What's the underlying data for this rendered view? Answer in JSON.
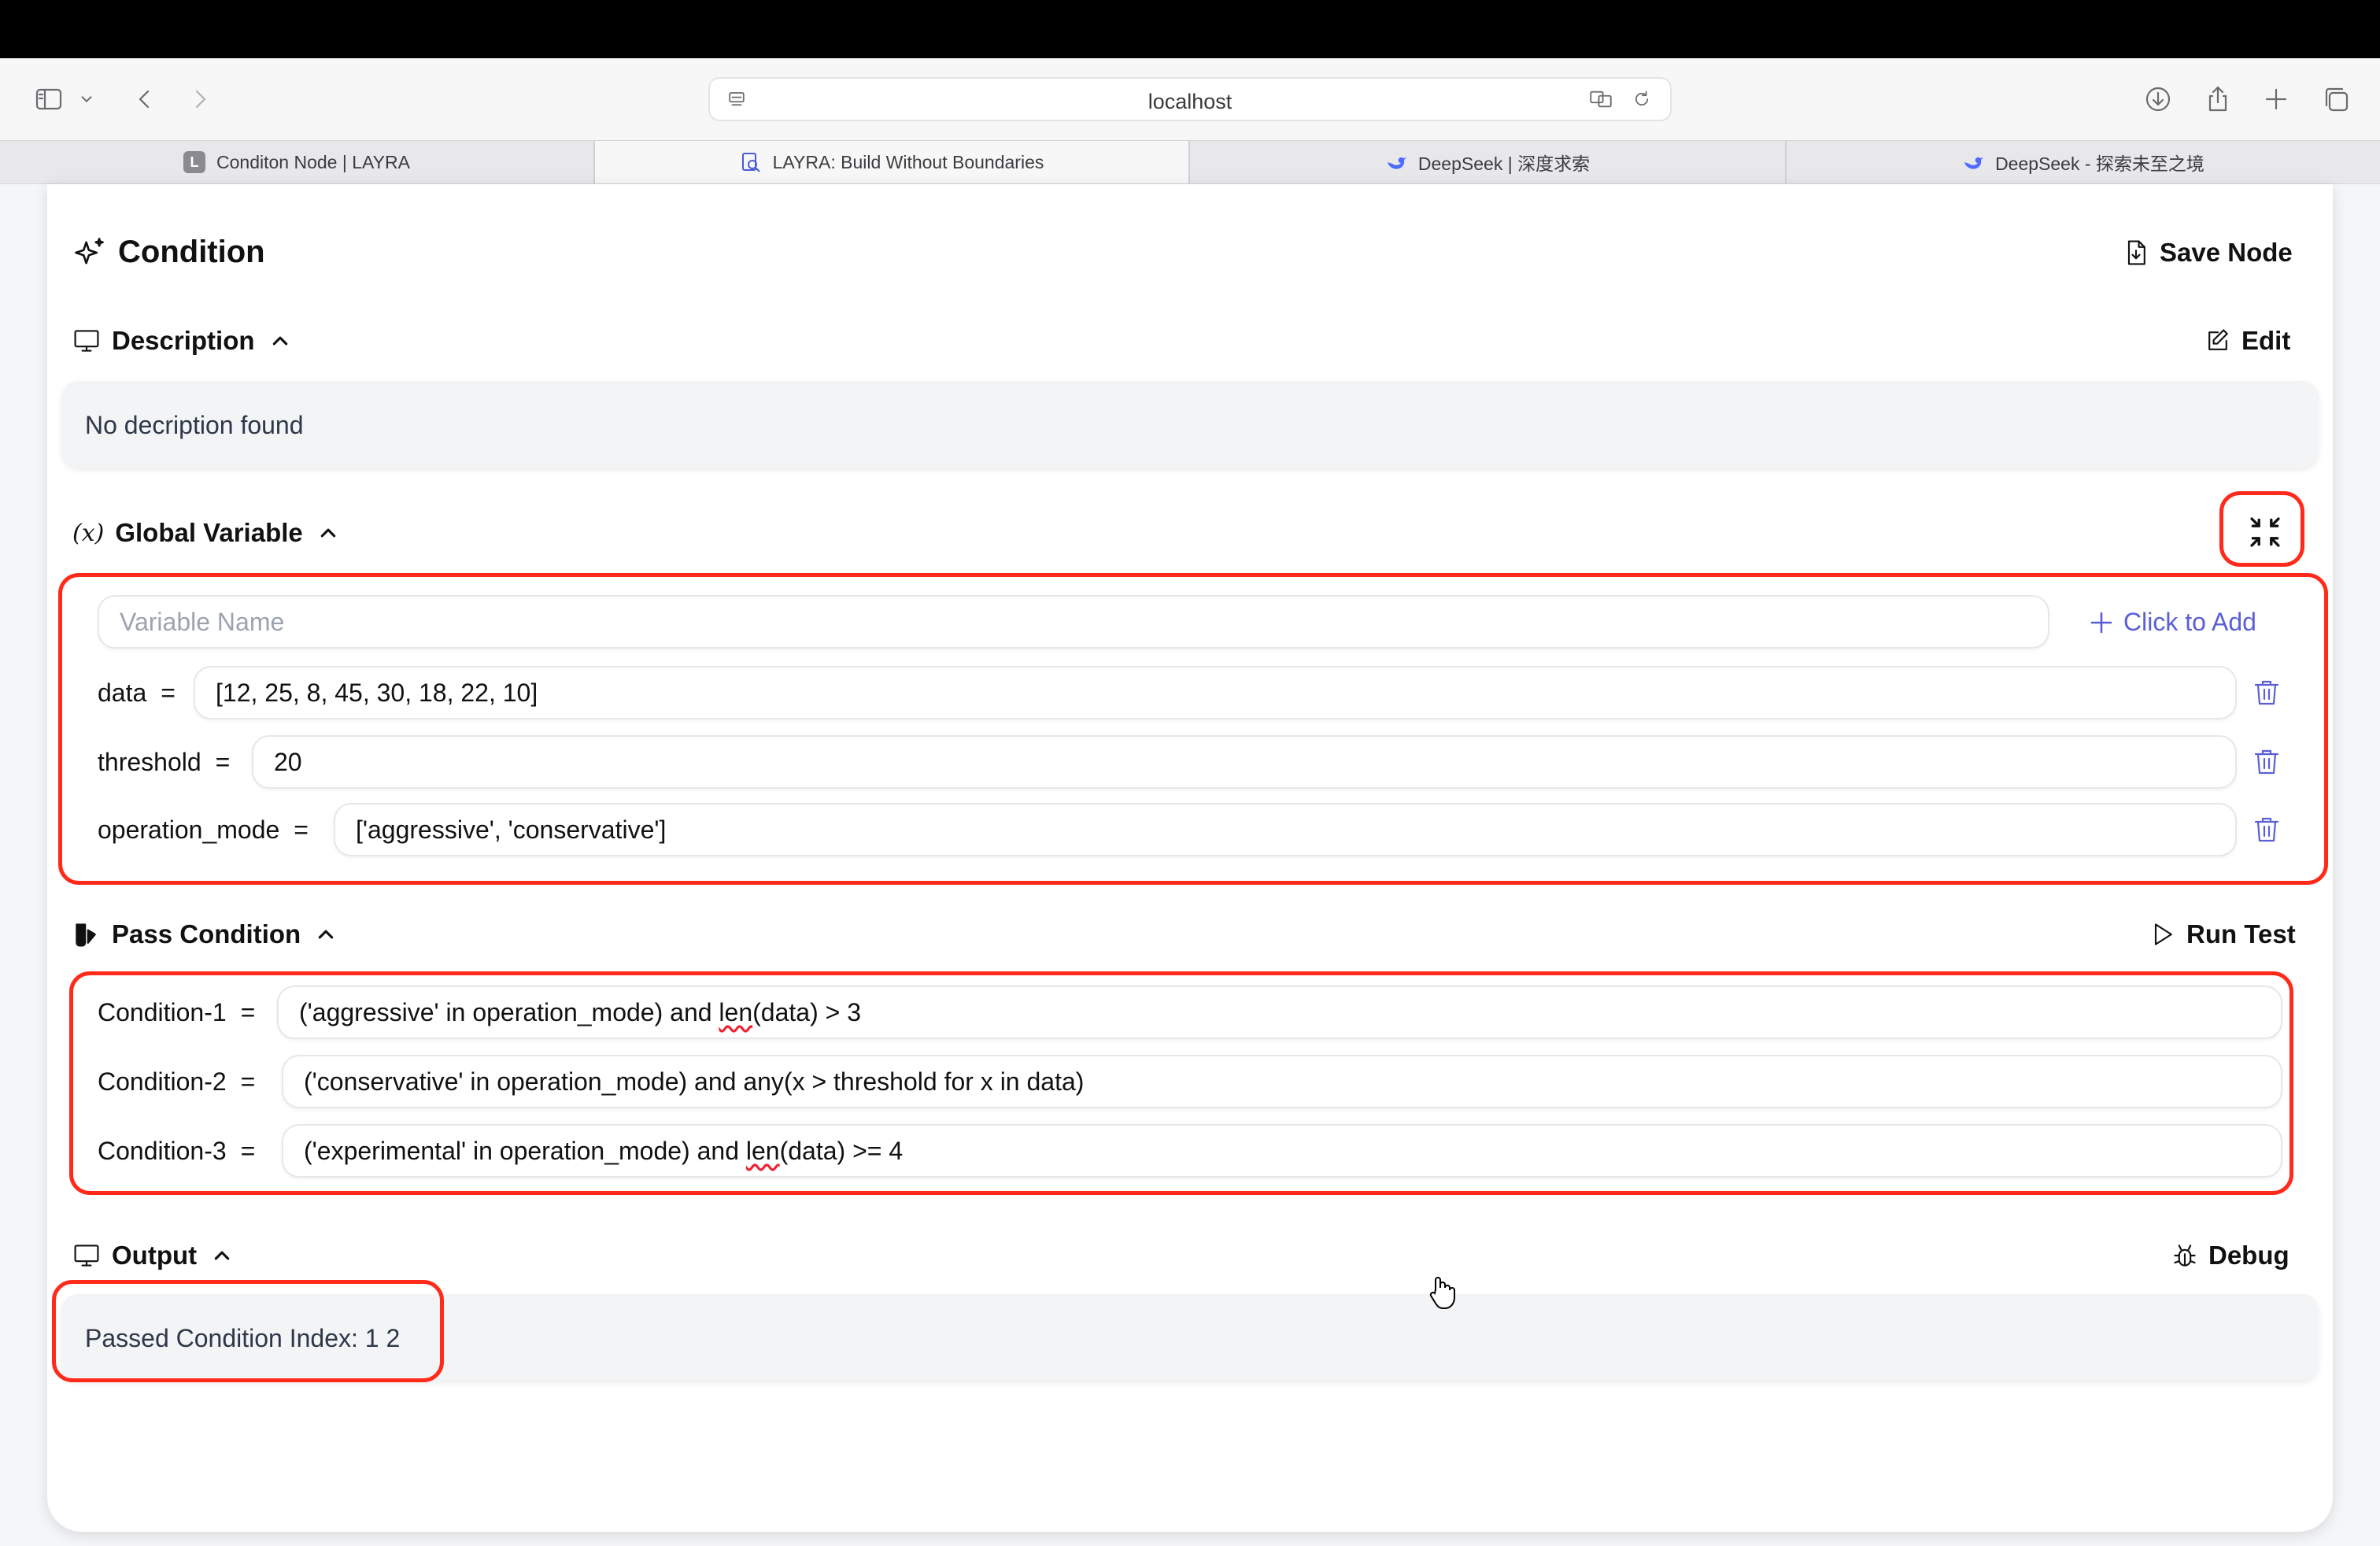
{
  "browser": {
    "url": "localhost",
    "tabs": [
      {
        "label": "Conditon Node | LAYRA",
        "favicon": "L",
        "active": false
      },
      {
        "label": "LAYRA: Build Without Boundaries",
        "favicon": "doc-search-icon",
        "active": true
      },
      {
        "label": "DeepSeek | 深度求索",
        "favicon": "whale-icon",
        "active": false
      },
      {
        "label": "DeepSeek - 探索未至之境",
        "favicon": "whale-icon",
        "active": false
      }
    ]
  },
  "node": {
    "title": "Condition",
    "save_label": "Save Node"
  },
  "description": {
    "title": "Description",
    "edit_label": "Edit",
    "text": "No decription found"
  },
  "global_variable": {
    "title": "Global Variable",
    "name_placeholder": "Variable Name",
    "add_label": "Click to Add",
    "variables": [
      {
        "name": "data",
        "value": "[12, 25, 8, 45, 30, 18, 22, 10]"
      },
      {
        "name": "threshold",
        "value": "20"
      },
      {
        "name": "operation_mode",
        "value": "['aggressive', 'conservative']"
      }
    ]
  },
  "pass_condition": {
    "title": "Pass Condition",
    "run_label": "Run Test",
    "conditions": [
      {
        "label": "Condition-1",
        "expr_pre": "('aggressive' in operation_mode) and ",
        "expr_fn": "len",
        "expr_post": "(data) > 3"
      },
      {
        "label": "Condition-2",
        "expr_pre": "('conservative' in operation_mode) and any(x > threshold for x in data)",
        "expr_fn": "",
        "expr_post": ""
      },
      {
        "label": "Condition-3",
        "expr_pre": "('experimental' in operation_mode) and ",
        "expr_fn": "len",
        "expr_post": "(data) >= 4"
      }
    ]
  },
  "output": {
    "title": "Output",
    "debug_label": "Debug",
    "text": "Passed Condition Index: 1 2"
  },
  "equals_sign": "=",
  "colors": {
    "accent": "#5b5fd6",
    "highlight": "#ff2a1a"
  }
}
